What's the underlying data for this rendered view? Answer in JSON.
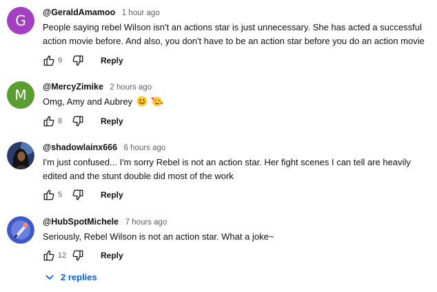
{
  "comments": [
    {
      "avatar_letter": "G",
      "avatar_color": "#a33fc1",
      "author": "@GeraldAmamoo",
      "time": "1 hour ago",
      "text": "People saying rebel Wilson isn't an actions star is just unnecessary. She has acted a successful action movie before. And also, you don't have to be an action star before you do an action movie",
      "likes": "9",
      "reply_label": "Reply"
    },
    {
      "avatar_letter": "M",
      "avatar_color": "#5a9e32",
      "author": "@MercyZimike",
      "time": "2 hours ago",
      "text": "Omg, Amy and Aubrey",
      "emoji_icons": [
        "smiling-face-emoji-icon",
        "smiling-face-with-hearts-emoji-icon"
      ],
      "likes": "8",
      "reply_label": "Reply"
    },
    {
      "avatar_icon": "profile-photo-avatar",
      "author": "@shadowlainx666",
      "time": "6 hours ago",
      "text": "I'm just confused... I'm sorry Rebel is not an action star. Her fight scenes I can tell are heavily edited and the stunt double did most of the work",
      "likes": "5",
      "reply_label": "Reply"
    },
    {
      "avatar_icon": "illustrated-avatar",
      "author": "@HubSpotMichele",
      "time": "7 hours ago",
      "text": "Seriously, Rebel Wilson is not an action star. What a joke~",
      "likes": "12",
      "reply_label": "Reply"
    }
  ],
  "replies_toggle": {
    "label": "2 replies",
    "icon": "chevron-down-icon",
    "color": "#065fd4"
  },
  "icons": {
    "like": "thumb-up-icon",
    "dislike": "thumb-down-icon"
  }
}
